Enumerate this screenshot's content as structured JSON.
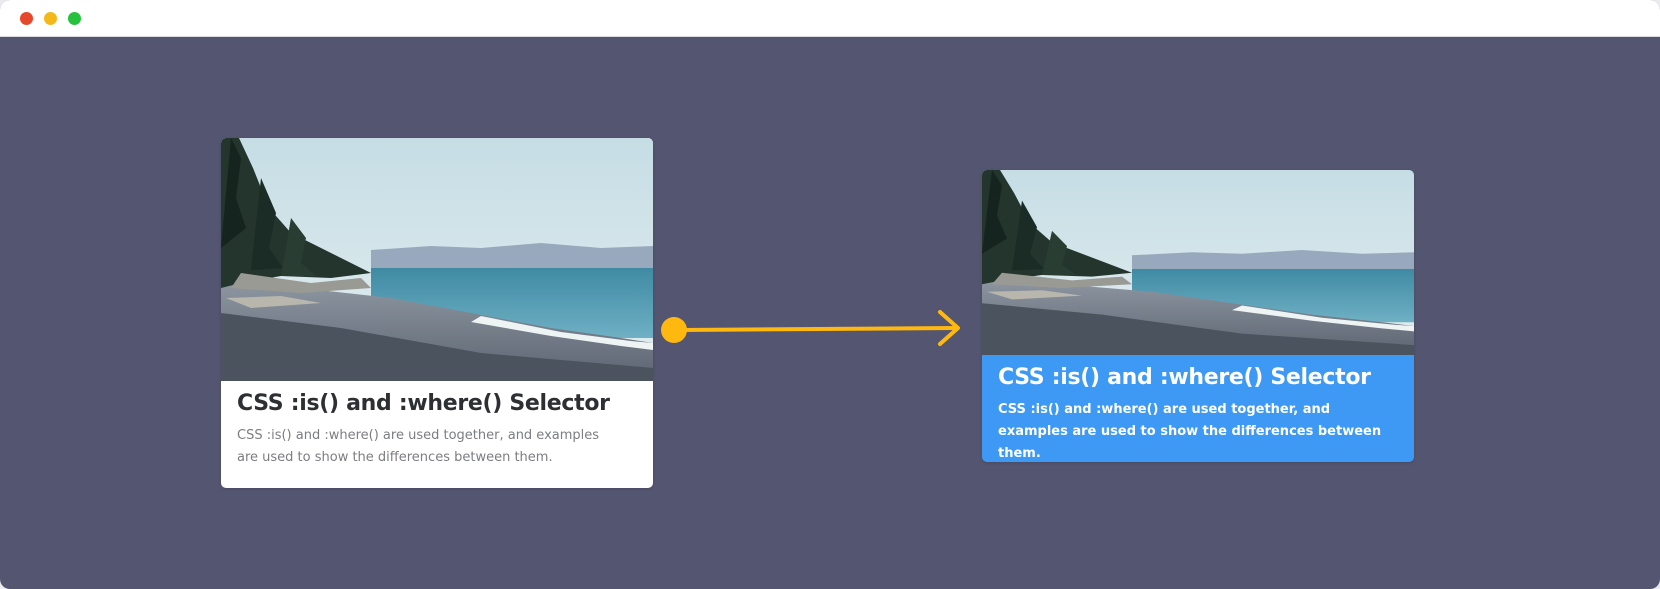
{
  "window": {
    "controls": [
      "close",
      "minimize",
      "maximize"
    ]
  },
  "cards": {
    "before": {
      "image": "beach-photo",
      "title": "CSS :is() and :where() Selector",
      "description": "CSS :is() and :where() are used together, and examples are used to show the differences between them."
    },
    "after": {
      "image": "beach-photo",
      "title": "CSS :is() and :where() Selector",
      "description": "CSS :is() and :where() are used together, and examples are used to show the differences between them."
    }
  },
  "colors": {
    "background": "#545570",
    "card_before": "#ffffff",
    "card_after": "#3d99f3",
    "arrow": "#ffb80f"
  },
  "icons": {
    "transition": "arrow-right-icon"
  }
}
